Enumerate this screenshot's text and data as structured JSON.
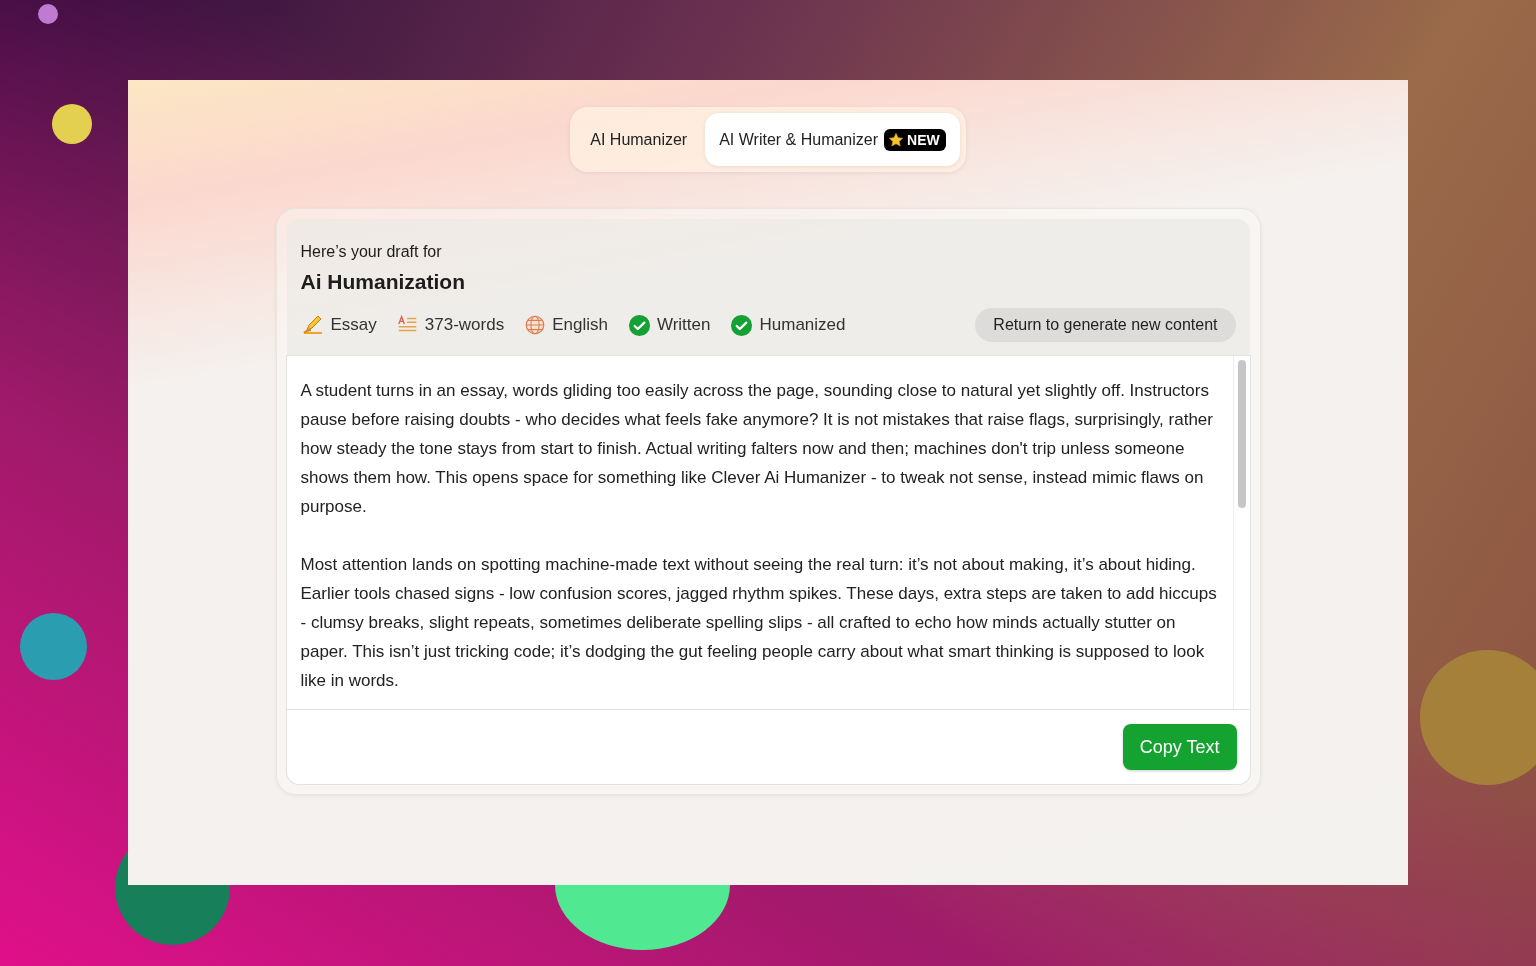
{
  "tabs": [
    {
      "label": "AI Humanizer",
      "selected": false
    },
    {
      "label": "AI Writer & Humanizer",
      "selected": true,
      "badge": "NEW"
    }
  ],
  "draft": {
    "intro": "Here’s your draft for",
    "title": "Ai Humanization",
    "meta": [
      {
        "kind": "pencil",
        "label": "Essay"
      },
      {
        "kind": "lines",
        "label": "373-words"
      },
      {
        "kind": "globe",
        "label": "English"
      },
      {
        "kind": "check",
        "label": "Written"
      },
      {
        "kind": "check",
        "label": "Humanized"
      }
    ],
    "return_button": "Return to generate new content",
    "paragraphs": [
      "A student turns in an essay, words gliding too easily across the page, sounding close to natural yet slightly off. Instructors pause before raising doubts - who decides what feels fake anymore? It is not mistakes that raise flags, surprisingly, rather how steady the tone stays from start to finish. Actual writing falters now and then; machines don't trip unless someone shows them how. This opens space for something like Clever Ai Humanizer - to tweak not sense, instead mimic flaws on purpose.",
      "Most attention lands on spotting machine-made text without seeing the real turn: it’s not about making, it’s about hiding. Earlier tools chased signs - low confusion scores, jagged rhythm spikes. These days, extra steps are taken to add hiccups - clumsy breaks, slight repeats, sometimes deliberate spelling slips - all crafted to echo how minds actually stutter on paper. This isn’t just tricking code; it’s dodging the gut feeling people carry about what smart thinking is supposed to look like in words."
    ],
    "copy_button": "Copy Text"
  }
}
